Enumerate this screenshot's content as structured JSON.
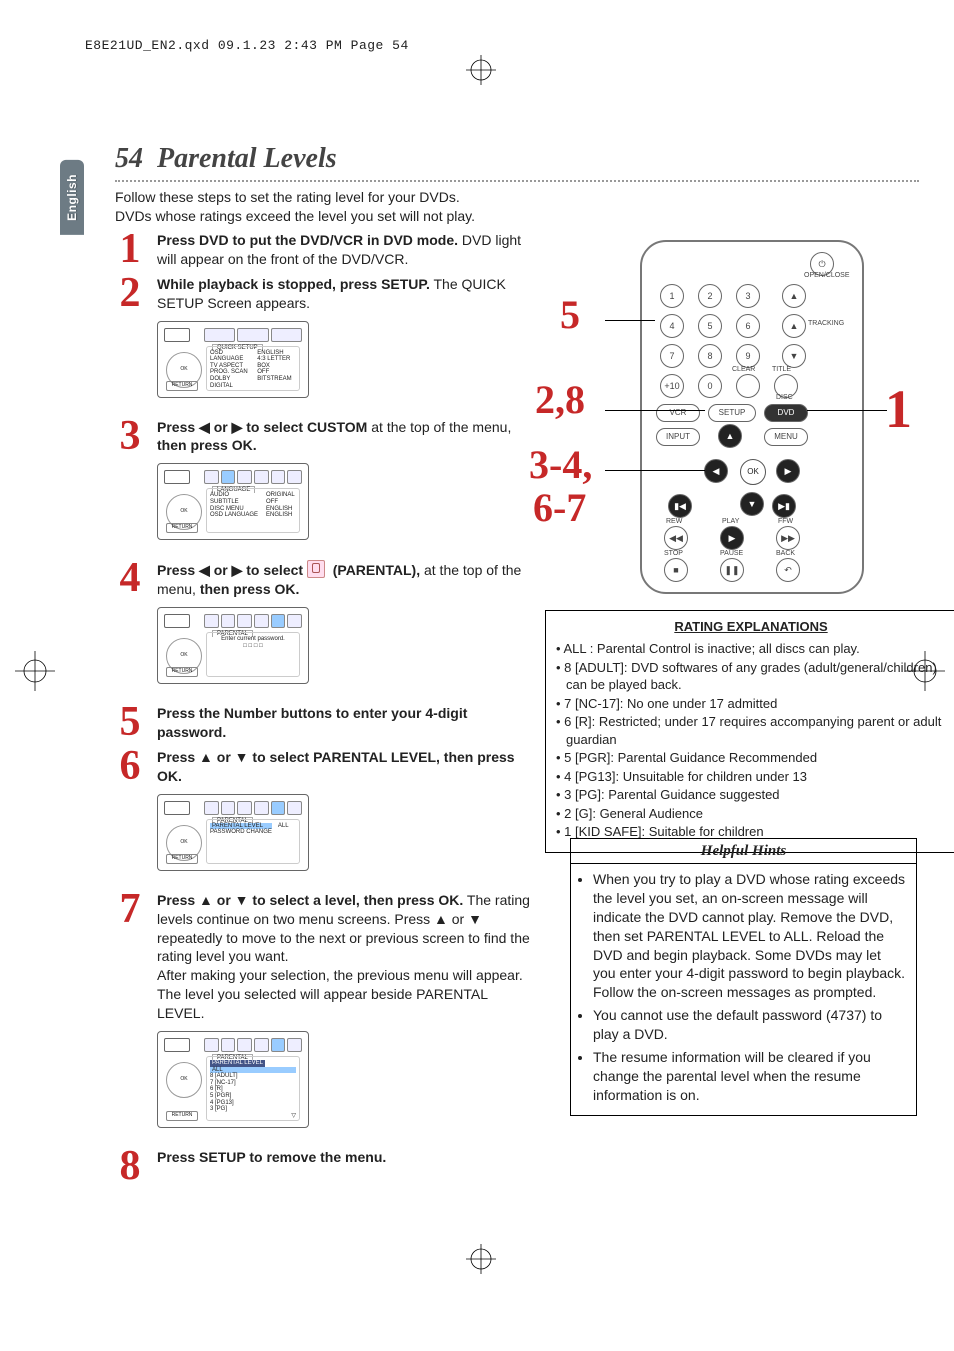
{
  "header_line": "E8E21UD_EN2.qxd  09.1.23  2:43 PM  Page 54",
  "lang_tab": "English",
  "page_number": "54",
  "page_title": "Parental Levels",
  "intro": "Follow these steps to set the rating level for your DVDs.\nDVDs whose ratings exceed the level you set will not play.",
  "steps": {
    "s1": {
      "n": "1",
      "bold": "Press DVD to put the DVD/VCR in DVD mode.",
      "rest": " DVD light will appear on the front of the DVD/VCR."
    },
    "s2": {
      "n": "2",
      "bold": "While playback is stopped, press SETUP.",
      "rest": " The QUICK SETUP Screen appears.",
      "screen_tab": "QUICK SETUP",
      "rows": [
        "OSD LANGUAGE",
        "TV ASPECT",
        "PROG. SCAN",
        "DOLBY DIGITAL"
      ],
      "vals": [
        "ENGLISH",
        "4:3 LETTER BOX",
        "OFF",
        "BITSTREAM"
      ]
    },
    "s3": {
      "n": "3",
      "pre": "Press ",
      "mid": "or",
      "post": " to select CUSTOM",
      "tail": " at the top of the menu, ",
      "bold2": "then press OK.",
      "screen_tab": "LANGUAGE",
      "rows": [
        "AUDIO",
        "SUBTITLE",
        "DISC MENU",
        "OSD LANGUAGE"
      ],
      "vals": [
        "ORIGINAL",
        "OFF",
        "ENGLISH",
        "ENGLISH"
      ]
    },
    "s4": {
      "n": "4",
      "pre": "Press ",
      "mid": "or",
      "post": " to select ",
      "par": "(PARENTAL),",
      "tail": " at the top of the menu, ",
      "bold2": "then press OK.",
      "screen_tab": "PARENTAL",
      "body": "Enter current password.",
      "boxes": "□ □ □ □"
    },
    "s5": {
      "n": "5",
      "bold": "Press the Number buttons to enter your 4-digit password."
    },
    "s6": {
      "n": "6",
      "bold": "Press ▲ or ▼ to select PARENTAL LEVEL, then press OK.",
      "screen_tab": "PARENTAL",
      "rows": [
        "PARENTAL LEVEL",
        "PASSWORD CHANGE"
      ],
      "vals": [
        "ALL",
        ""
      ]
    },
    "s7": {
      "n": "7",
      "bold": "Press ▲ or ▼ to select a level, then press OK.",
      "rest": " The rating levels continue on two menu screens. Press ▲ or ▼ repeatedly to move to the next or previous screen to find the rating level you want.\nAfter making your selection, the previous menu will appear. The level you selected will appear beside PARENTAL LEVEL.",
      "screen_tab": "PARENTAL",
      "sub": "PARENTAL LEVEL",
      "rows": [
        "ALL",
        "8 [ADULT]",
        "7 [NC-17]",
        "6 [R]",
        "5 [PGR]",
        "4 [PG13]",
        "3 [PG]"
      ]
    },
    "s8": {
      "n": "8",
      "bold": "Press SETUP to remove the menu."
    }
  },
  "remote": {
    "labels": {
      "open": "OPEN/CLOSE",
      "tracking": "TRACKING",
      "clear": "CLEAR",
      "title": "TITLE",
      "disc": "DISC",
      "menu": "MENU",
      "input": "INPUT",
      "rew": "REW",
      "play": "PLAY",
      "ffw": "FFW",
      "stop": "STOP",
      "pause": "PAUSE",
      "back": "BACK",
      "vcr": "VCR",
      "setup": "SETUP",
      "dvd": "DVD",
      "plus10": "+10",
      "ok": "OK"
    },
    "nums": [
      "1",
      "2",
      "3",
      "4",
      "5",
      "6",
      "7",
      "8",
      "9",
      "0"
    ]
  },
  "callouts": {
    "n5": "5",
    "n28": "2,8",
    "n1": "1",
    "n34": "3-4,",
    "n67": "6-7"
  },
  "ratings": {
    "title": "RATING EXPLANATIONS",
    "items": [
      "ALL : Parental Control is inactive; all discs can play.",
      "8 [ADULT]: DVD softwares of any grades (adult/general/children) can be played back.",
      "7 [NC-17]: No one under 17 admitted",
      "6 [R]: Restricted; under 17 requires accompanying parent or adult guardian",
      "5 [PGR]: Parental Guidance Recommended",
      "4 [PG13]: Unsuitable for children under 13",
      "3 [PG]: Parental Guidance suggested",
      "2 [G]: General Audience",
      "1 [KID SAFE]: Suitable for children"
    ]
  },
  "hints": {
    "title": "Helpful Hints",
    "items": [
      "When you try to play a DVD whose rating exceeds the level you set, an on-screen message will indicate the DVD cannot play. Remove the DVD, then set PARENTAL LEVEL to ALL. Reload the DVD and begin playback. Some DVDs may let you enter your 4-digit password to begin playback. Follow the on-screen messages as prompted.",
      "You cannot use the default password (4737) to play a DVD.",
      "The resume information will be cleared if you change the parental level when the resume information is on."
    ]
  }
}
